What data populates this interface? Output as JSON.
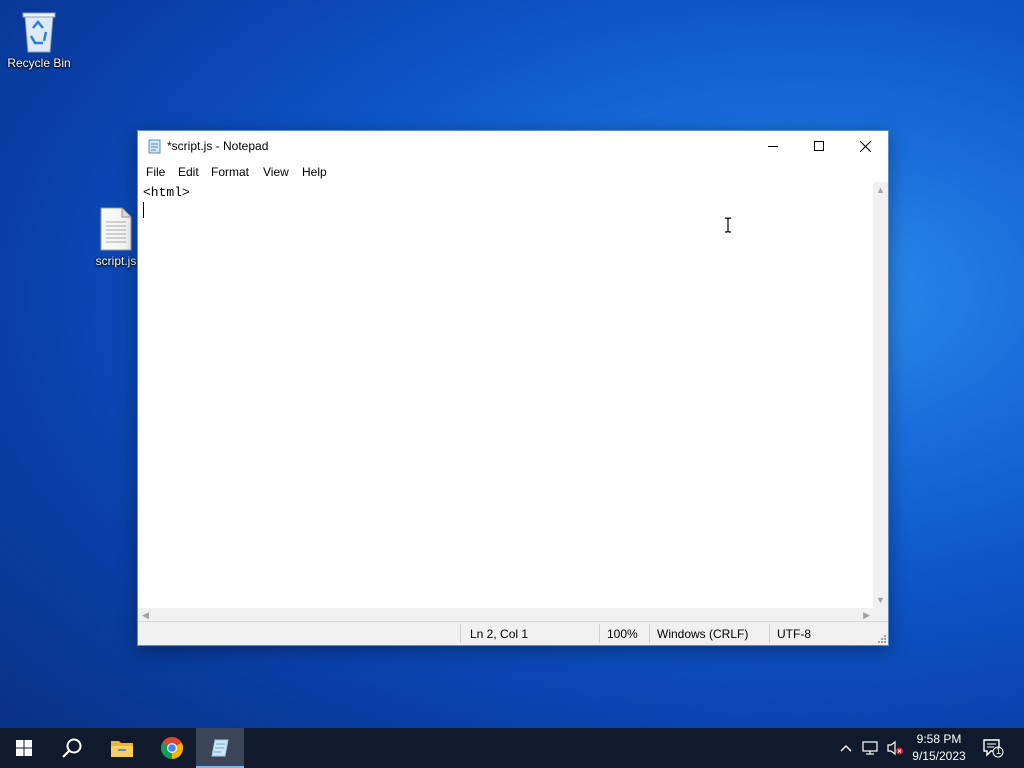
{
  "desktop": {
    "icons": [
      {
        "label": "Recycle Bin",
        "icon": "recycle-bin-icon"
      },
      {
        "label": "script.js",
        "icon": "text-file-icon"
      }
    ]
  },
  "window": {
    "title": "*script.js - Notepad",
    "menu": [
      "File",
      "Edit",
      "Format",
      "View",
      "Help"
    ],
    "content": "<html>",
    "status": {
      "position": "Ln 2, Col 1",
      "zoom": "100%",
      "line_ending": "Windows (CRLF)",
      "encoding": "UTF-8"
    }
  },
  "taskbar": {
    "apps": [
      "start-icon",
      "search-icon",
      "file-explorer-icon",
      "chrome-icon",
      "notepad-icon"
    ],
    "time": "9:58 PM",
    "date": "9/15/2023",
    "notification_count": "1"
  },
  "colors": {
    "taskbar_bg": "#101a2c",
    "active_indicator": "#76b9ed",
    "desktop_blue": "#0d55c8"
  }
}
